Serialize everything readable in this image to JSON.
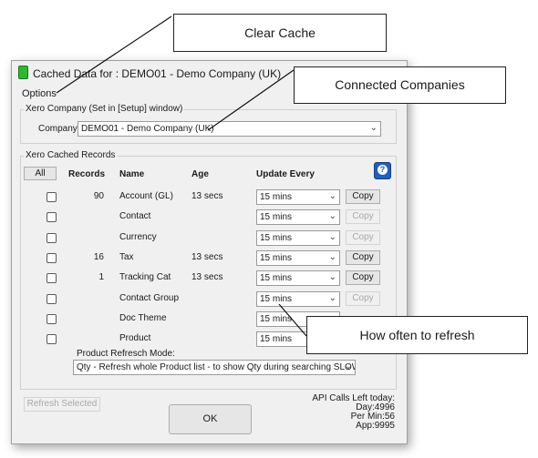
{
  "window": {
    "title": "Cached Data for : DEMO01 - Demo Company (UK)"
  },
  "menu": {
    "options": "Options"
  },
  "xero_company": {
    "group_label": "Xero Company (Set in [Setup] window)",
    "company_label": "Company:",
    "company_value": "DEMO01 - Demo Company (UK)"
  },
  "cached": {
    "group_label": "Xero Cached Records",
    "all_button": "All",
    "headers": {
      "records": "Records",
      "name": "Name",
      "age": "Age",
      "update": "Update Every"
    },
    "rows": [
      {
        "records": "90",
        "name": "Account (GL)",
        "age": "13 secs",
        "update": "15 mins",
        "copy": "Copy",
        "copy_enabled": true
      },
      {
        "records": "",
        "name": "Contact",
        "age": "",
        "update": "15 mins",
        "copy": "Copy",
        "copy_enabled": false
      },
      {
        "records": "",
        "name": "Currency",
        "age": "",
        "update": "15 mins",
        "copy": "Copy",
        "copy_enabled": false
      },
      {
        "records": "16",
        "name": "Tax",
        "age": "13 secs",
        "update": "15 mins",
        "copy": "Copy",
        "copy_enabled": true
      },
      {
        "records": "1",
        "name": "Tracking Cat",
        "age": "13 secs",
        "update": "15 mins",
        "copy": "Copy",
        "copy_enabled": true
      },
      {
        "records": "",
        "name": "Contact Group",
        "age": "",
        "update": "15 mins",
        "copy": "Copy",
        "copy_enabled": false
      },
      {
        "records": "",
        "name": "Doc Theme",
        "age": "",
        "update": "15 mins",
        "copy": "",
        "copy_enabled": false
      },
      {
        "records": "",
        "name": "Product",
        "age": "",
        "update": "15 mins",
        "copy": "",
        "copy_enabled": false
      }
    ],
    "product_mode_label": "Product Refresch Mode:",
    "product_mode_value": "Qty - Refresh whole Product list - to show Qty during searching SLOWER"
  },
  "footer": {
    "refresh_button": "Refresh Selected",
    "ok_button": "OK",
    "api_title": "API Calls Left today:",
    "api_day": "Day:4996",
    "api_min": "Per Min:56",
    "api_app": "App:9995"
  },
  "callouts": {
    "clear_cache": "Clear Cache",
    "connected": "Connected Companies",
    "refresh": "How often to refresh"
  },
  "icons": {
    "help": "help-icon",
    "app": "app-icon",
    "dropdown": "chevron-down-icon"
  },
  "colors": {
    "help_blue": "#1f5fbf",
    "app_green": "#2eb82e"
  }
}
